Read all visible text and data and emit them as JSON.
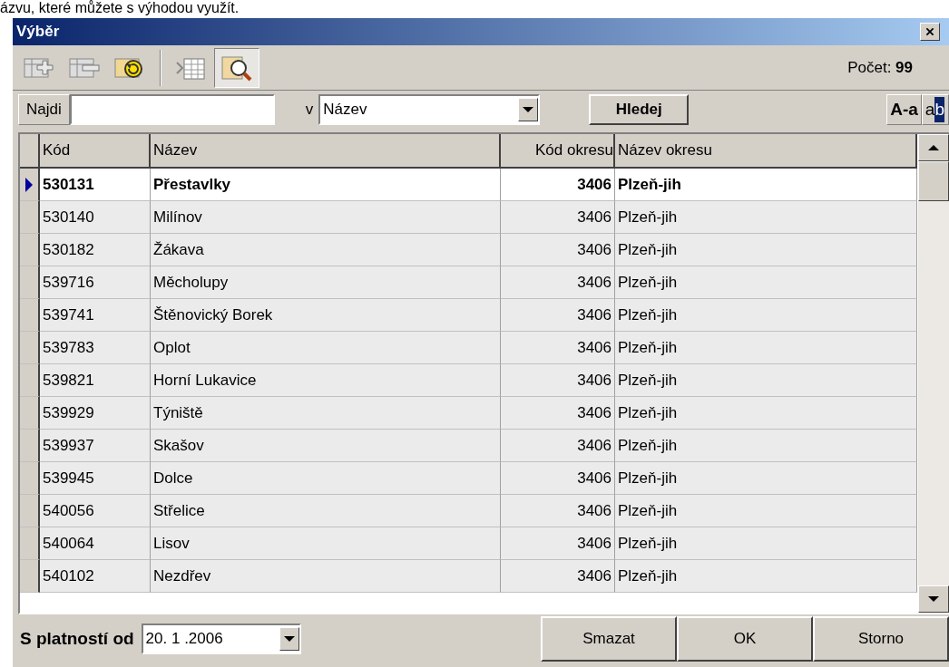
{
  "page_text": "ázvu, které můžete s výhodou využít.",
  "window": {
    "title": "Výběr"
  },
  "toolbar": {
    "buttons": [
      {
        "kind": "add",
        "selected": false
      },
      {
        "kind": "remove",
        "selected": false
      },
      {
        "kind": "refresh",
        "selected": false
      },
      {
        "kind": "columns",
        "selected": false
      },
      {
        "kind": "search",
        "selected": true
      }
    ],
    "count": "Počet: **99**"
  },
  "search": {
    "label": "Najdi",
    "in_label": "v",
    "field": "Název",
    "button": "Hledej",
    "case_toggle": "A-a",
    "match_toggle": {
      "before": "a",
      "highlight": "b"
    }
  },
  "table": {
    "columns": [
      "Kód",
      "Název",
      "Kód okresu",
      "Název okresu"
    ],
    "rows": [
      {
        "cells": [
          "530131",
          "Přestavlky",
          "3406",
          "Plzeň-jih"
        ],
        "selected": true
      },
      {
        "cells": [
          "530140",
          "Milínov",
          "3406",
          "Plzeň-jih"
        ],
        "selected": false
      },
      {
        "cells": [
          "530182",
          "Žákava",
          "3406",
          "Plzeň-jih"
        ],
        "selected": false
      },
      {
        "cells": [
          "539716",
          "Měcholupy",
          "3406",
          "Plzeň-jih"
        ],
        "selected": false
      },
      {
        "cells": [
          "539741",
          "Štěnovický Borek",
          "3406",
          "Plzeň-jih"
        ],
        "selected": false
      },
      {
        "cells": [
          "539783",
          "Oplot",
          "3406",
          "Plzeň-jih"
        ],
        "selected": false
      },
      {
        "cells": [
          "539821",
          "Horní Lukavice",
          "3406",
          "Plzeň-jih"
        ],
        "selected": false
      },
      {
        "cells": [
          "539929",
          "Týniště",
          "3406",
          "Plzeň-jih"
        ],
        "selected": false
      },
      {
        "cells": [
          "539937",
          "Skašov",
          "3406",
          "Plzeň-jih"
        ],
        "selected": false
      },
      {
        "cells": [
          "539945",
          "Dolce",
          "3406",
          "Plzeň-jih"
        ],
        "selected": false
      },
      {
        "cells": [
          "540056",
          "Střelice",
          "3406",
          "Plzeň-jih"
        ],
        "selected": false
      },
      {
        "cells": [
          "540064",
          "Lisov",
          "3406",
          "Plzeň-jih"
        ],
        "selected": false
      },
      {
        "cells": [
          "540102",
          "Nezdřev",
          "3406",
          "Plzeň-jih"
        ],
        "selected": false
      }
    ]
  },
  "footer": {
    "label": "S platností od",
    "date": "20. 1 .2006",
    "buttons": [
      "Smazat",
      "OK",
      "Storno"
    ]
  }
}
